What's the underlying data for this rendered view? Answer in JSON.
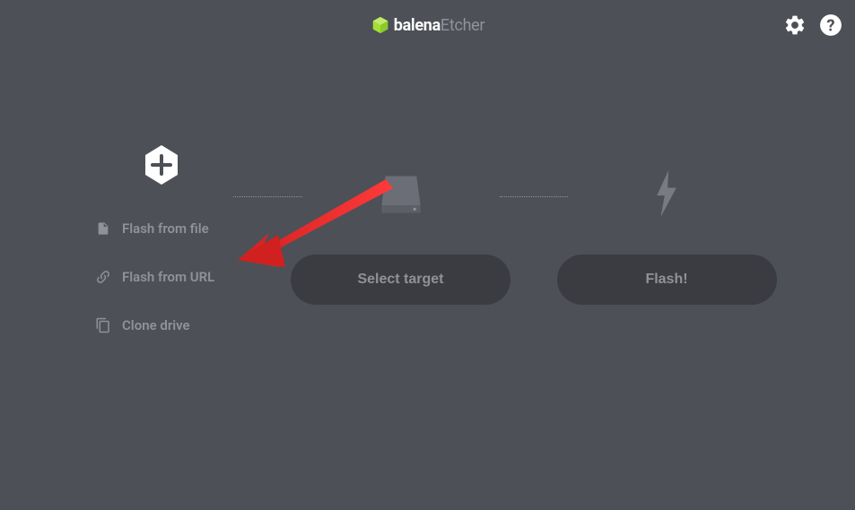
{
  "app": {
    "name_bold": "balena",
    "name_light": "Etcher"
  },
  "source_options": {
    "flash_from_file": "Flash from file",
    "flash_from_url": "Flash from URL",
    "clone_drive": "Clone drive"
  },
  "buttons": {
    "select_target": "Select target",
    "flash": "Flash!"
  }
}
